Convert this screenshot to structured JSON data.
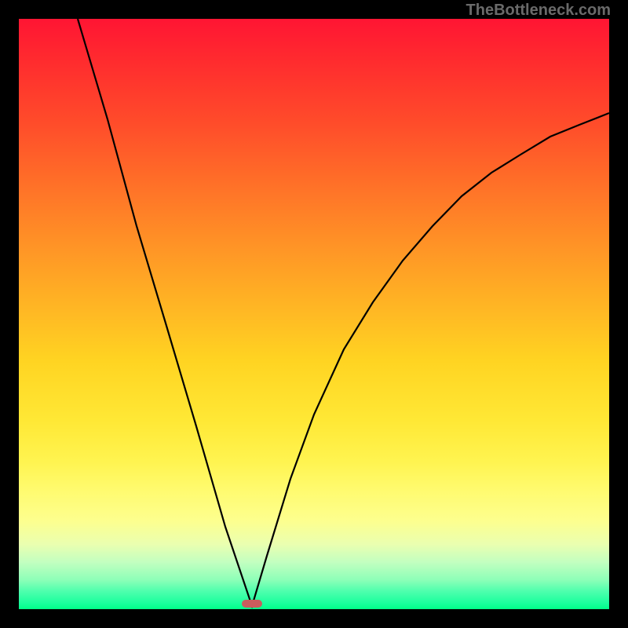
{
  "watermark": "TheBottleneck.com",
  "chart_data": {
    "type": "line",
    "title": "",
    "xlabel": "",
    "ylabel": "",
    "x_range": [
      0,
      100
    ],
    "y_range": [
      0,
      100
    ],
    "minimum_at_x": 39,
    "series": [
      {
        "name": "curve",
        "points": [
          {
            "x": 10,
            "y": 100
          },
          {
            "x": 15,
            "y": 83
          },
          {
            "x": 20,
            "y": 65
          },
          {
            "x": 25,
            "y": 48
          },
          {
            "x": 30,
            "y": 31
          },
          {
            "x": 35,
            "y": 14
          },
          {
            "x": 39,
            "y": 0.5
          },
          {
            "x": 42,
            "y": 9
          },
          {
            "x": 46,
            "y": 22
          },
          {
            "x": 50,
            "y": 33
          },
          {
            "x": 55,
            "y": 44
          },
          {
            "x": 60,
            "y": 52
          },
          {
            "x": 65,
            "y": 59
          },
          {
            "x": 70,
            "y": 65
          },
          {
            "x": 75,
            "y": 70
          },
          {
            "x": 80,
            "y": 74
          },
          {
            "x": 85,
            "y": 77
          },
          {
            "x": 90,
            "y": 80
          },
          {
            "x": 95,
            "y": 82
          },
          {
            "x": 100,
            "y": 84
          }
        ]
      }
    ],
    "marker": {
      "x": 39,
      "y": 0.5,
      "color": "#c95d5d"
    }
  }
}
